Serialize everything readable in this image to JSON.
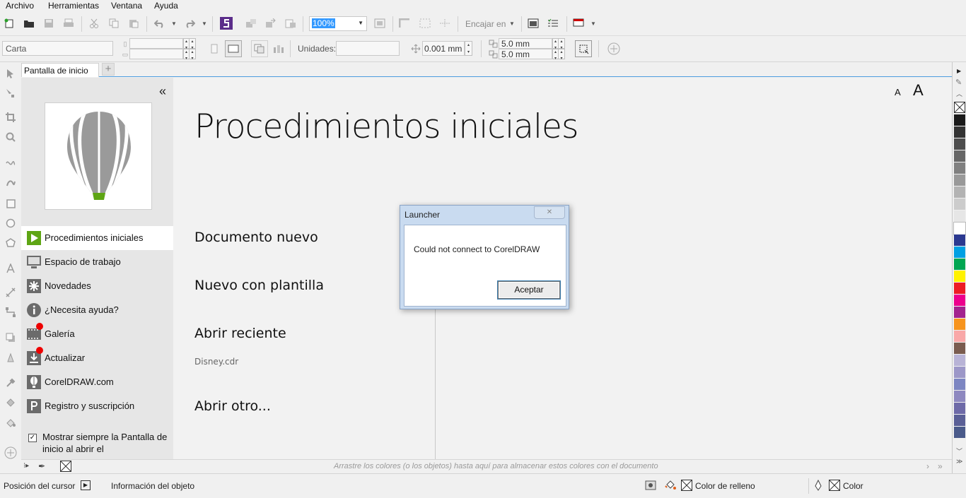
{
  "menu": {
    "items": [
      {
        "label": "Archivo"
      },
      {
        "label": "Herramientas"
      },
      {
        "label": "Ventana"
      },
      {
        "label": "Ayuda"
      }
    ]
  },
  "toolbar": {
    "zoom_value": "100%",
    "snap_label": "Encajar en"
  },
  "property_bar": {
    "page_size": "Carta",
    "units_label": "Unidades:",
    "nudge_value": "0.001 mm",
    "dup_x": "5.0 mm",
    "dup_y": "5.0 mm"
  },
  "tabs": [
    {
      "label": "Pantalla de inicio",
      "active": true
    }
  ],
  "sidebar": {
    "collapse_glyph": "«",
    "items": [
      {
        "label": "Procedimientos iniciales",
        "icon": "play-icon",
        "active": true
      },
      {
        "label": "Espacio de trabajo",
        "icon": "monitor-icon"
      },
      {
        "label": "Novedades",
        "icon": "star-burst-icon"
      },
      {
        "label": "¿Necesita ayuda?",
        "icon": "info-icon"
      },
      {
        "label": "Galería",
        "icon": "film-icon",
        "notification": true
      },
      {
        "label": "Actualizar",
        "icon": "download-icon",
        "notification": true
      },
      {
        "label": "CorelDRAW.com",
        "icon": "balloon-icon"
      },
      {
        "label": "Registro y suscripción",
        "icon": "p-icon"
      }
    ],
    "show_always": {
      "checked": true,
      "label": "Mostrar siempre la Pantalla de inicio al abrir el"
    }
  },
  "main": {
    "title": "Procedimientos iniciales",
    "font_small": "A",
    "font_large": "A",
    "actions": [
      {
        "label": "Documento nuevo"
      },
      {
        "label": "Nuevo con plantilla"
      },
      {
        "label": "Abrir reciente"
      },
      {
        "label": "Abrir otro..."
      }
    ],
    "recent_files": [
      "Disney.cdr"
    ]
  },
  "document_palette": {
    "hint": "Arrastre los colores (o los objetos) hasta aquí para almacenar estos colores con el documento"
  },
  "statusbar": {
    "cursor_position": "Posición del cursor",
    "object_info": "Información del objeto",
    "fill_label": "Color de relleno",
    "outline_label": "Color"
  },
  "palette": {
    "colors": [
      "#1a1a1a",
      "#333333",
      "#4d4d4d",
      "#666666",
      "#808080",
      "#999999",
      "#b3b3b3",
      "#cccccc",
      "#e6e6e6",
      "#ffffff",
      "#2b3990",
      "#00a0e3",
      "#00a651",
      "#fff200",
      "#ed1c24",
      "#ec008c",
      "#a3238e",
      "#f7941d",
      "#f9a8a8",
      "#7a5c4f",
      "#b8b3d6",
      "#9c97c8",
      "#7d86c2",
      "#8e88c0",
      "#6e6aa8",
      "#5a5f96",
      "#4a5a8a"
    ]
  },
  "dialog": {
    "title": "Launcher",
    "message": "Could not connect to CorelDRAW",
    "ok_label": "Aceptar"
  }
}
